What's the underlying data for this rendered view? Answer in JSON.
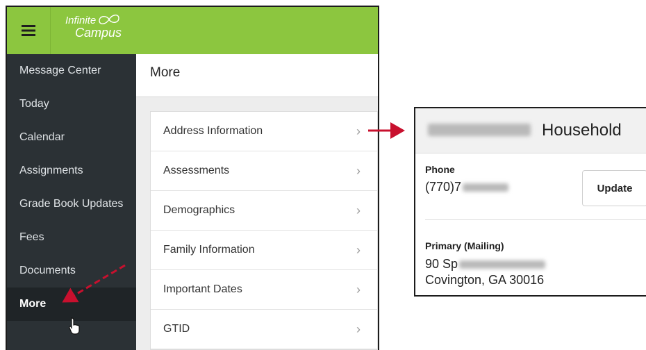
{
  "app": {
    "logo_line1": "Infinite",
    "logo_line2": "Campus",
    "brand_color": "#8cc63f"
  },
  "sidebar": {
    "items": [
      {
        "label": "Message Center"
      },
      {
        "label": "Today"
      },
      {
        "label": "Calendar"
      },
      {
        "label": "Assignments"
      },
      {
        "label": "Grade Book Updates"
      },
      {
        "label": "Fees"
      },
      {
        "label": "Documents"
      },
      {
        "label": "More",
        "active": true
      }
    ]
  },
  "main": {
    "title": "More",
    "rows": [
      {
        "label": "Address Information",
        "icon": "chevron-right-icon"
      },
      {
        "label": "Assessments",
        "icon": "chevron-right-icon"
      },
      {
        "label": "Demographics",
        "icon": "chevron-right-icon"
      },
      {
        "label": "Family Information",
        "icon": "chevron-right-icon"
      },
      {
        "label": "Important Dates",
        "icon": "chevron-right-icon"
      },
      {
        "label": "GTID",
        "icon": "chevron-right-icon"
      }
    ],
    "chevron": "›"
  },
  "household": {
    "title": "Household",
    "phone_label": "Phone",
    "phone_value": "(770)7",
    "update_label": "Update",
    "mailing_label": "Primary (Mailing)",
    "address_line1": "90 Sp",
    "address_line2": "Covington, GA 30016"
  },
  "annotation_color": "#c8102e"
}
